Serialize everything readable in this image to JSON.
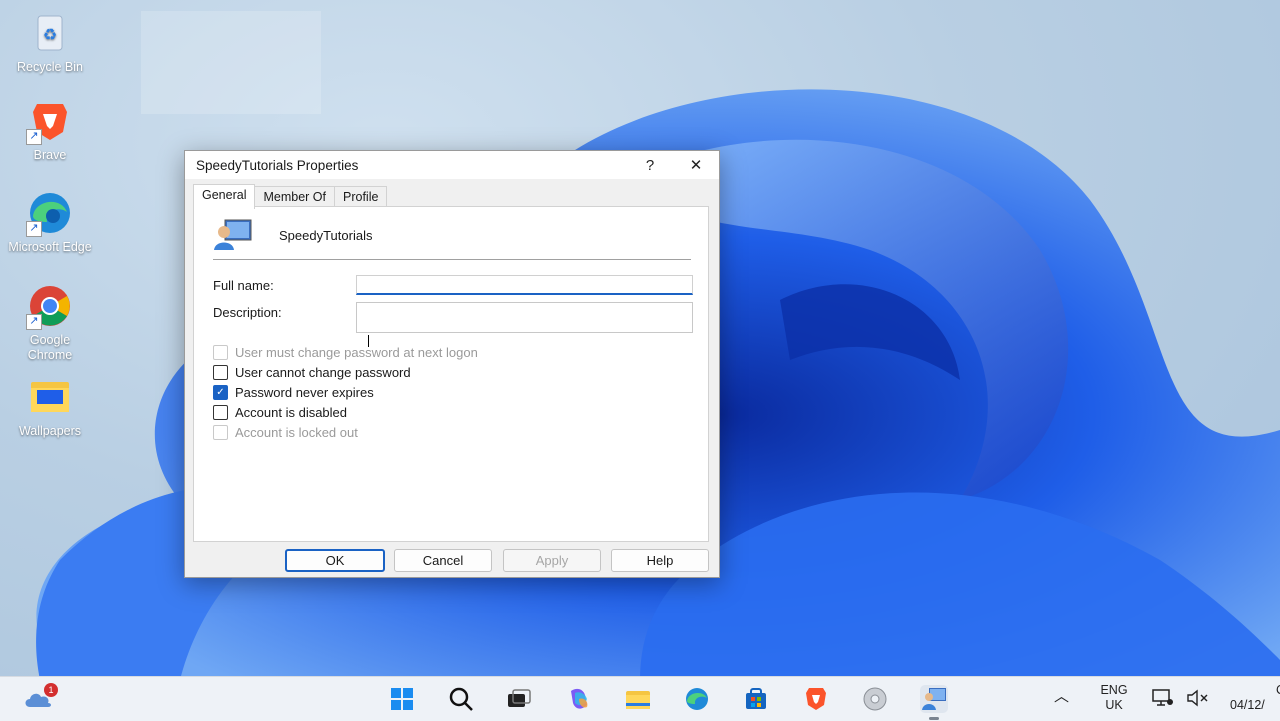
{
  "desktop": {
    "icons": [
      {
        "label": "Recycle Bin",
        "icon": "recycle-bin-icon"
      },
      {
        "label": "Brave",
        "icon": "brave-icon"
      },
      {
        "label": "Microsoft Edge",
        "icon": "edge-icon"
      },
      {
        "label": "Google Chrome",
        "icon": "chrome-icon"
      },
      {
        "label": "Wallpapers",
        "icon": "folder-icon"
      }
    ]
  },
  "dialog": {
    "title": "SpeedyTutorials Properties",
    "help_glyph": "?",
    "close_glyph": "✕",
    "tabs": [
      "General",
      "Member Of",
      "Profile"
    ],
    "active_tab": "General",
    "user_name": "SpeedyTutorials",
    "full_name_label": "Full name:",
    "full_name_value": "",
    "description_label": "Description:",
    "description_value": "",
    "checkboxes": [
      {
        "label": "User must change password at next logon",
        "checked": false,
        "disabled": true
      },
      {
        "label": "User cannot change password",
        "checked": false,
        "disabled": false
      },
      {
        "label": "Password never expires",
        "checked": true,
        "disabled": false
      },
      {
        "label": "Account is disabled",
        "checked": false,
        "disabled": false
      },
      {
        "label": "Account is locked out",
        "checked": false,
        "disabled": true
      }
    ],
    "buttons": {
      "ok": "OK",
      "cancel": "Cancel",
      "apply": "Apply",
      "help": "Help"
    }
  },
  "taskbar": {
    "weather_badge": "1",
    "language_line1": "ENG",
    "language_line2": "UK",
    "date": "04/12/",
    "time_partial": "C"
  },
  "colors": {
    "accent": "#1a62c4",
    "wallpaper_blue": "#1f5ee8"
  }
}
